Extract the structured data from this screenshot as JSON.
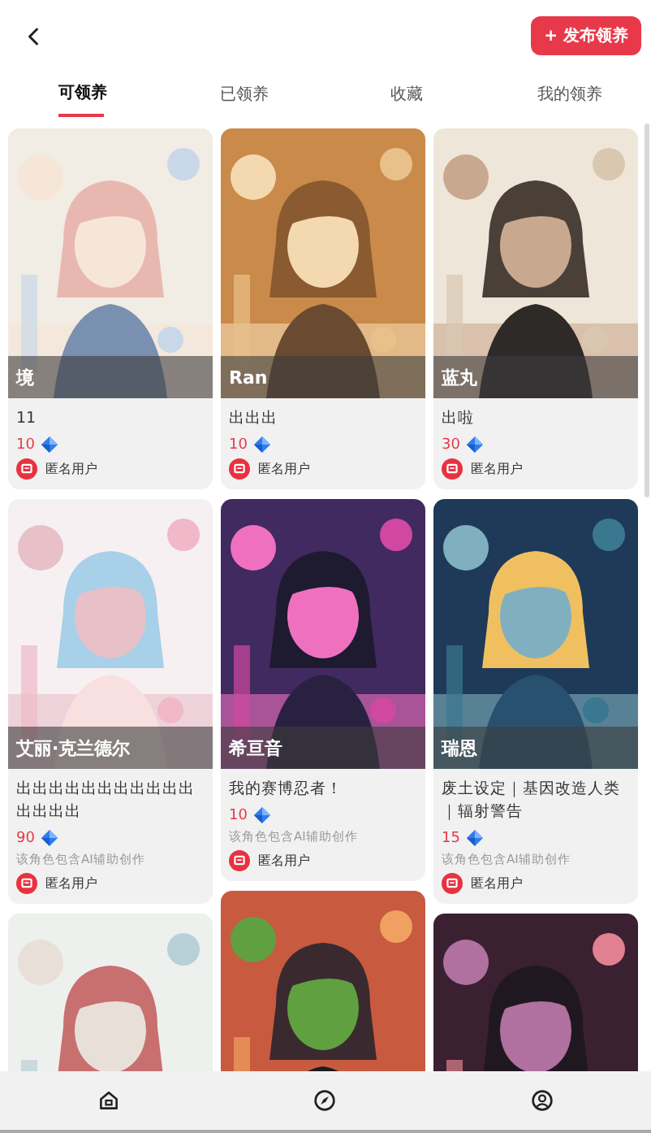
{
  "header": {
    "publish_button": "+ 发布领养"
  },
  "tabs": [
    {
      "label": "可领养",
      "selected": true
    },
    {
      "label": "已领养",
      "selected": false
    },
    {
      "label": "收藏",
      "selected": false
    },
    {
      "label": "我的领养",
      "selected": false
    }
  ],
  "columns": [
    [
      {
        "kind": "card",
        "title": "境",
        "description": "11",
        "price": "10",
        "user": "匿名用户"
      },
      {
        "kind": "card",
        "title": "艾丽·克兰德尔",
        "description": "出出出出出出出出出出出出出出出",
        "price": "90",
        "ai_note": "该角色包含AI辅助创作",
        "user": "匿名用户"
      },
      {
        "kind": "picture"
      }
    ],
    [
      {
        "kind": "card",
        "title": "Ran",
        "description": "出出出",
        "price": "10",
        "user": "匿名用户"
      },
      {
        "kind": "card",
        "title": "希亘音",
        "description": "我的赛博忍者！",
        "price": "10",
        "ai_note": "该角色包含AI辅助创作",
        "user": "匿名用户"
      },
      {
        "kind": "picture"
      }
    ],
    [
      {
        "kind": "card",
        "title": "蓝丸",
        "description": "出啦",
        "price": "30",
        "user": "匿名用户"
      },
      {
        "kind": "card",
        "title": "瑞恩",
        "description": "废土设定｜基因改造人类｜辐射警告",
        "price": "15",
        "ai_note": "该角色包含AI辅助创作",
        "user": "匿名用户"
      },
      {
        "kind": "picture"
      }
    ]
  ]
}
